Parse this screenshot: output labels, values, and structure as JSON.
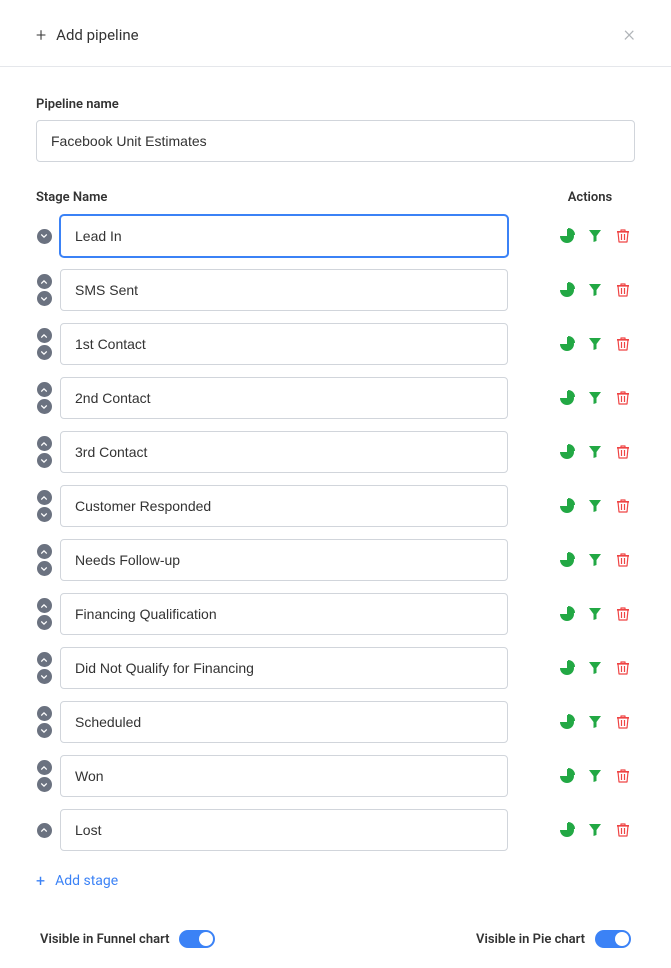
{
  "header": {
    "title": "Add pipeline"
  },
  "pipeline": {
    "label": "Pipeline name",
    "value": "Facebook Unit Estimates"
  },
  "columns": {
    "stageName": "Stage Name",
    "actions": "Actions"
  },
  "stages": [
    {
      "name": "Lead In",
      "canMoveUp": false,
      "canMoveDown": true,
      "focused": true
    },
    {
      "name": "SMS Sent",
      "canMoveUp": true,
      "canMoveDown": true,
      "focused": false
    },
    {
      "name": "1st Contact",
      "canMoveUp": true,
      "canMoveDown": true,
      "focused": false
    },
    {
      "name": "2nd Contact",
      "canMoveUp": true,
      "canMoveDown": true,
      "focused": false
    },
    {
      "name": "3rd Contact",
      "canMoveUp": true,
      "canMoveDown": true,
      "focused": false
    },
    {
      "name": "Customer Responded",
      "canMoveUp": true,
      "canMoveDown": true,
      "focused": false
    },
    {
      "name": "Needs Follow-up",
      "canMoveUp": true,
      "canMoveDown": true,
      "focused": false
    },
    {
      "name": "Financing Qualification",
      "canMoveUp": true,
      "canMoveDown": true,
      "focused": false
    },
    {
      "name": "Did Not Qualify for Financing",
      "canMoveUp": true,
      "canMoveDown": true,
      "focused": false
    },
    {
      "name": "Scheduled",
      "canMoveUp": true,
      "canMoveDown": true,
      "focused": false
    },
    {
      "name": "Won",
      "canMoveUp": true,
      "canMoveDown": true,
      "focused": false
    },
    {
      "name": "Lost",
      "canMoveUp": true,
      "canMoveDown": false,
      "focused": false
    }
  ],
  "addStage": {
    "label": "Add stage"
  },
  "toggles": {
    "funnelLabel": "Visible in Funnel chart",
    "pieLabel": "Visible in Pie chart"
  },
  "icons": {
    "pie": "pie-chart-icon",
    "funnel": "funnel-icon",
    "trash": "trash-icon"
  },
  "colors": {
    "green": "#22a844",
    "red": "#ef4444"
  }
}
